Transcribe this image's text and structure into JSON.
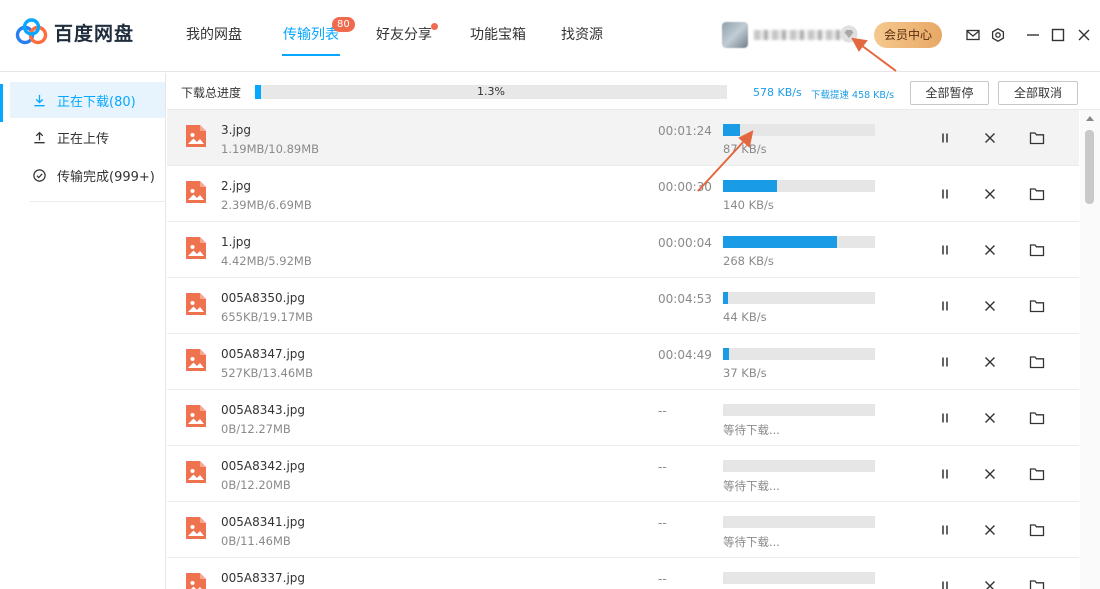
{
  "app": {
    "logo_text": "百度网盘"
  },
  "nav": {
    "tabs": [
      {
        "label": "我的网盘"
      },
      {
        "label": "传输列表",
        "badge": "80"
      },
      {
        "label": "好友分享"
      },
      {
        "label": "功能宝箱"
      },
      {
        "label": "找资源"
      }
    ],
    "active_index": 1
  },
  "header": {
    "vip_label": "会员中心"
  },
  "sidebar": {
    "items": [
      {
        "label": "正在下载(80)",
        "icon": "download-icon"
      },
      {
        "label": "正在上传",
        "icon": "upload-icon"
      },
      {
        "label": "传输完成(999+)",
        "icon": "check-circle-icon"
      }
    ]
  },
  "toolbar": {
    "total_label": "下载总进度",
    "total_percent": "1.3%",
    "total_fraction": 0.013,
    "speed": "578 KB/s",
    "speed_boost": "下载提速 458 KB/s",
    "pause_all": "全部暂停",
    "cancel_all": "全部取消"
  },
  "downloads": [
    {
      "name": "3.jpg",
      "size": "1.19MB/10.89MB",
      "eta": "00:01:24",
      "progress": 0.109,
      "rate": "87 KB/s"
    },
    {
      "name": "2.jpg",
      "size": "2.39MB/6.69MB",
      "eta": "00:00:30",
      "progress": 0.357,
      "rate": "140 KB/s"
    },
    {
      "name": "1.jpg",
      "size": "4.42MB/5.92MB",
      "eta": "00:00:04",
      "progress": 0.747,
      "rate": "268 KB/s"
    },
    {
      "name": "005A8350.jpg",
      "size": "655KB/19.17MB",
      "eta": "00:04:53",
      "progress": 0.033,
      "rate": "44 KB/s"
    },
    {
      "name": "005A8347.jpg",
      "size": "527KB/13.46MB",
      "eta": "00:04:49",
      "progress": 0.038,
      "rate": "37 KB/s"
    },
    {
      "name": "005A8343.jpg",
      "size": "0B/12.27MB",
      "eta": "--",
      "progress": 0,
      "rate": "等待下载..."
    },
    {
      "name": "005A8342.jpg",
      "size": "0B/12.20MB",
      "eta": "--",
      "progress": 0,
      "rate": "等待下载..."
    },
    {
      "name": "005A8341.jpg",
      "size": "0B/11.46MB",
      "eta": "--",
      "progress": 0,
      "rate": "等待下载..."
    },
    {
      "name": "005A8337.jpg",
      "size": "",
      "eta": "--",
      "progress": 0,
      "rate": ""
    }
  ],
  "colors": {
    "accent": "#06a7ff",
    "progress": "#1a9be6",
    "badge": "#f06a4e",
    "file_icon": "#f0734f",
    "annotation_arrow": "#e4683f",
    "vip_gold": "#f0b878"
  }
}
